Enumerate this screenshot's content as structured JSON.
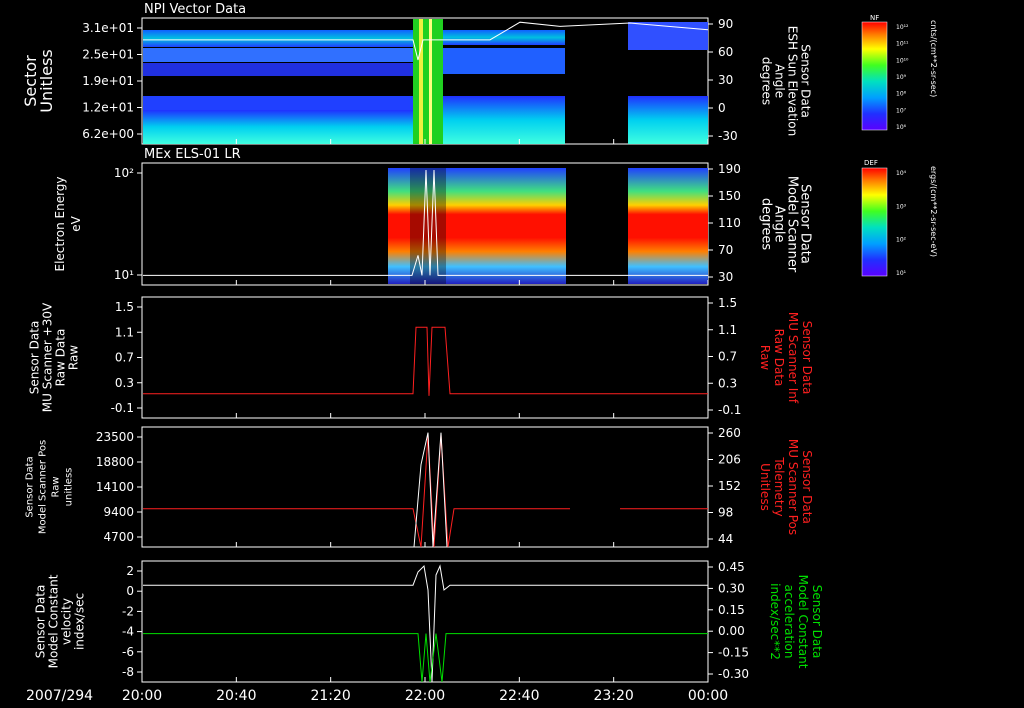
{
  "date_label": "2007/294",
  "x_ticks": [
    "20:00",
    "20:40",
    "21:20",
    "22:00",
    "22:40",
    "23:20",
    "00:00"
  ],
  "colorbars": [
    {
      "tag": "NF",
      "unit": "cnts/(cm**2-sr-sec)",
      "ticks": [
        "10¹²",
        "10¹¹",
        "10¹⁰",
        "10⁹",
        "10⁸",
        "10⁷",
        "10⁶"
      ]
    },
    {
      "tag": "DEF",
      "unit": "ergs/(cm**2-sr-sec-eV)",
      "ticks": [
        "10⁴",
        "10³",
        "10²",
        "10¹"
      ]
    }
  ],
  "chart_data": [
    {
      "type": "heatmap",
      "title": "NPI Vector Data",
      "ylabel": [
        "Sector",
        "Unitless"
      ],
      "yticks": [
        "3.1e+01",
        "2.5e+01",
        "1.9e+01",
        "1.2e+01",
        "6.2e+00"
      ],
      "right_label": [
        "Sensor Data",
        "ESH Sun Elevation",
        "Angle",
        "degrees"
      ],
      "right_ticks": [
        "90",
        "60",
        "30",
        "0",
        "-30"
      ],
      "right_range": [
        -60,
        90
      ],
      "overlay_trace": {
        "color": "#ffffff",
        "x_hours": [
          0,
          4.1,
          4.15,
          4.3,
          4.6,
          5.5,
          6.3,
          7
        ],
        "y": [
          64,
          64,
          40,
          64,
          64,
          85,
          82,
          77
        ]
      }
    },
    {
      "type": "heatmap",
      "title": "MEx ELS-01 LR",
      "ylabel": [
        "Electron Energy",
        "eV"
      ],
      "yticks": [
        "10²",
        "10¹"
      ],
      "right_label": [
        "Sensor Data",
        "Model Scanner",
        "Angle",
        "degrees"
      ],
      "right_ticks": [
        "190",
        "150",
        "110",
        "70",
        "30"
      ],
      "right_range": [
        0,
        190
      ],
      "overlay_trace": {
        "color": "#ffffff",
        "baseline": 15
      }
    },
    {
      "type": "line",
      "ylabel": [
        "Sensor Data",
        "MU Scanner +30V",
        "Raw Data",
        "Raw"
      ],
      "yticks": [
        "1.5",
        "1.1",
        "0.7",
        "0.3",
        "-0.1"
      ],
      "right_label": [
        "Sensor Data",
        "MU Scanner Inf",
        "Raw Data",
        "Raw"
      ],
      "right_ticks": [
        "1.5",
        "1.1",
        "0.7",
        "0.3",
        "-0.1"
      ],
      "ylim": [
        -0.5,
        1.5
      ],
      "series": [
        {
          "color": "#ff2020",
          "baseline": -0.1,
          "pulse": 1.0
        }
      ]
    },
    {
      "type": "line",
      "ylabel": [
        "Sensor Data",
        "Model Scanner Pos",
        "Raw",
        "unitless"
      ],
      "yticks": [
        "23500",
        "18800",
        "14100",
        "9400",
        "4700"
      ],
      "right_label": [
        "Sensor Data",
        "MU Scanner Pos",
        "Telemetry",
        "Unitless"
      ],
      "right_ticks": [
        "260",
        "206",
        "152",
        "98",
        "44"
      ],
      "ylim": [
        0,
        23500
      ],
      "series": [
        {
          "color": "#ff2020",
          "baseline": 7500,
          "peak": 22000
        }
      ]
    },
    {
      "type": "line",
      "ylabel": [
        "Sensor Data",
        "Model Constant",
        "velocity",
        "index/sec"
      ],
      "yticks": [
        "2",
        "0",
        "-2",
        "-4",
        "-6",
        "-8"
      ],
      "right_label": [
        "Sensor Data",
        "Model Constant",
        "acceleration",
        "index/sec**2"
      ],
      "right_ticks": [
        "0.45",
        "0.30",
        "0.15",
        "0.00",
        "-0.15",
        "-0.30"
      ],
      "ylim": [
        -8,
        2
      ],
      "series": [
        {
          "color": "#ffffff",
          "baseline": 0
        },
        {
          "color": "#00e000",
          "baseline": -4
        }
      ]
    }
  ],
  "colors": {
    "red_label": "#ff2020",
    "green_label": "#00e000"
  }
}
